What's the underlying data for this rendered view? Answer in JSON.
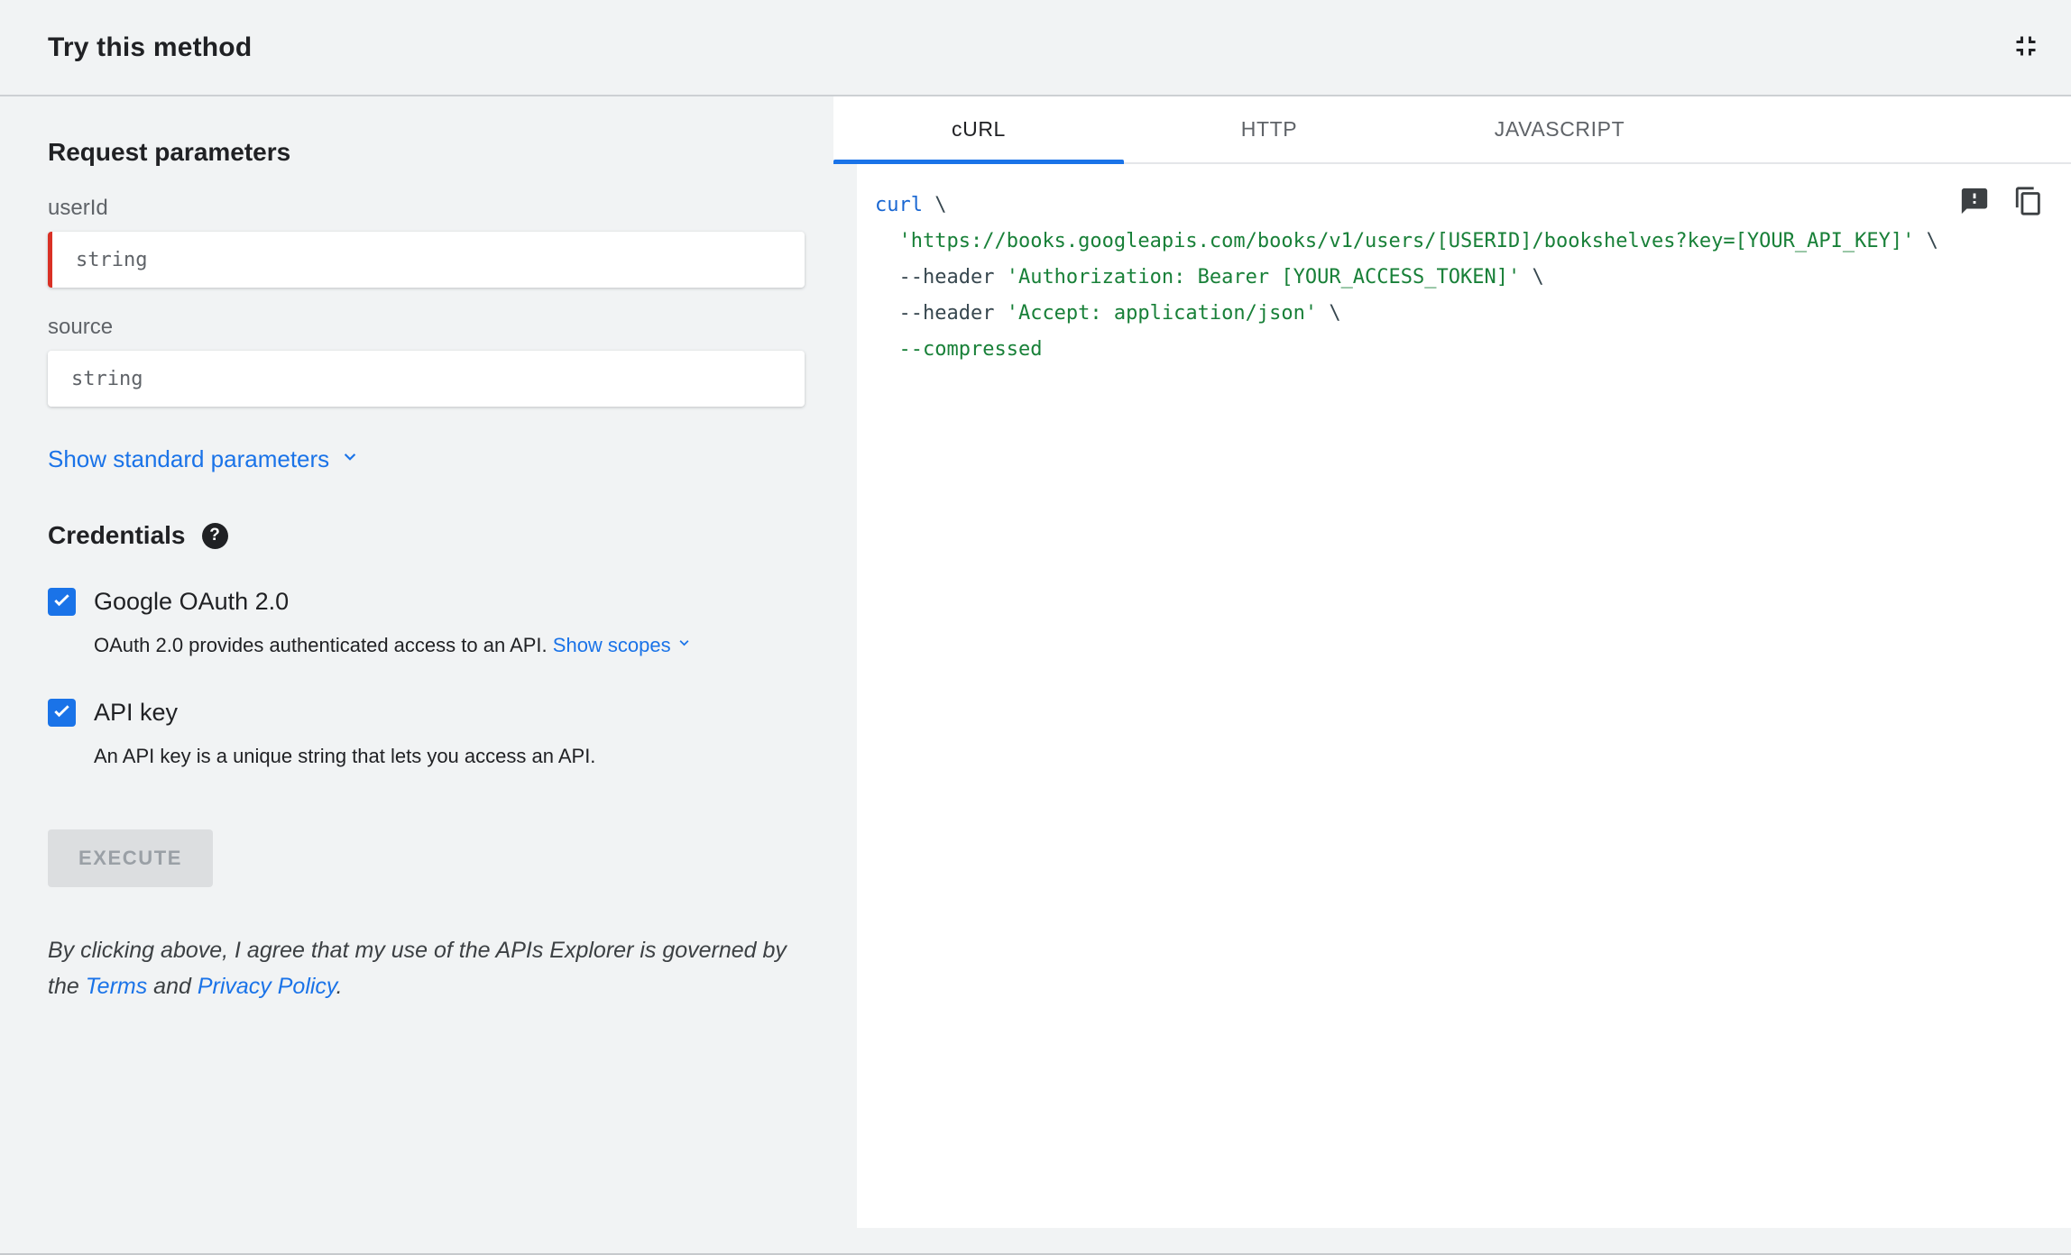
{
  "header": {
    "title": "Try this method"
  },
  "icons": {
    "collapse": "fullscreen-exit-icon",
    "help": "help-icon",
    "chevron": "chevron-down-icon",
    "check": "check-icon",
    "feedback": "feedback-icon",
    "copy": "copy-icon"
  },
  "colors": {
    "accent": "#1a73e8",
    "required_bar": "#d93025",
    "panel_bg": "#f1f3f4",
    "code_keyword": "#1967d2",
    "code_string": "#188038",
    "code_plain": "#37474f"
  },
  "request": {
    "heading": "Request parameters",
    "fields": [
      {
        "label": "userId",
        "placeholder": "string",
        "value": "",
        "required": true
      },
      {
        "label": "source",
        "placeholder": "string",
        "value": "",
        "required": false
      }
    ],
    "show_standard": "Show standard parameters"
  },
  "credentials": {
    "heading": "Credentials",
    "help": "?",
    "oauth": {
      "label": "Google OAuth 2.0",
      "checked": true,
      "desc": "OAuth 2.0 provides authenticated access to an API.",
      "link": "Show scopes"
    },
    "apikey": {
      "label": "API key",
      "checked": true,
      "desc": "An API key is a unique string that lets you access an API."
    }
  },
  "execute": {
    "label": "EXECUTE",
    "disabled": true
  },
  "disclaimer": {
    "text1": "By clicking above, I agree that my use of the APIs Explorer is governed by the ",
    "terms": "Terms",
    "text2": " and ",
    "privacy": "Privacy Policy",
    "text3": "."
  },
  "tabs": [
    {
      "label": "cURL",
      "active": true
    },
    {
      "label": "HTTP",
      "active": false
    },
    {
      "label": "JAVASCRIPT",
      "active": false
    }
  ],
  "code": {
    "lines": [
      [
        {
          "t": "curl",
          "c": "kw"
        },
        {
          "t": " \\",
          "c": "plain"
        }
      ],
      [
        {
          "t": "  ",
          "c": "plain"
        },
        {
          "t": "'https://books.googleapis.com/books/v1/users/[USERID]/bookshelves?key=[YOUR_API_KEY]'",
          "c": "str"
        },
        {
          "t": " \\",
          "c": "plain"
        }
      ],
      [
        {
          "t": "  --header ",
          "c": "plain"
        },
        {
          "t": "'Authorization: Bearer [YOUR_ACCESS_TOKEN]'",
          "c": "str"
        },
        {
          "t": " \\",
          "c": "plain"
        }
      ],
      [
        {
          "t": "  --header ",
          "c": "plain"
        },
        {
          "t": "'Accept: application/json'",
          "c": "str"
        },
        {
          "t": " \\",
          "c": "plain"
        }
      ],
      [
        {
          "t": "  ",
          "c": "plain"
        },
        {
          "t": "--compressed",
          "c": "str"
        }
      ]
    ]
  }
}
